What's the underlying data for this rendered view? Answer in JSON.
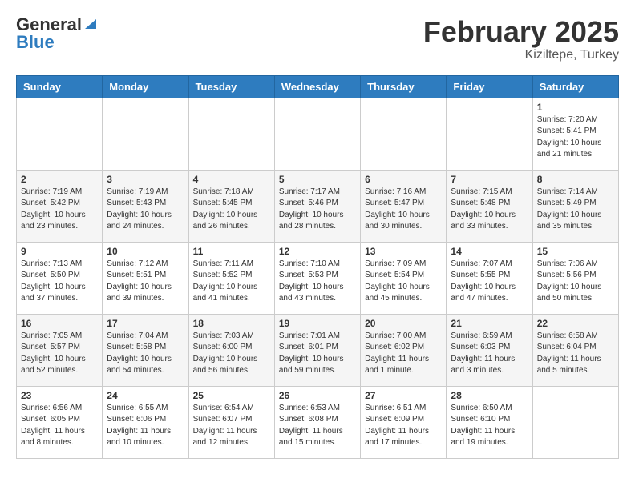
{
  "header": {
    "logo_general": "General",
    "logo_blue": "Blue",
    "month": "February 2025",
    "location": "Kiziltepe, Turkey"
  },
  "weekdays": [
    "Sunday",
    "Monday",
    "Tuesday",
    "Wednesday",
    "Thursday",
    "Friday",
    "Saturday"
  ],
  "weeks": [
    [
      {
        "day": "",
        "info": ""
      },
      {
        "day": "",
        "info": ""
      },
      {
        "day": "",
        "info": ""
      },
      {
        "day": "",
        "info": ""
      },
      {
        "day": "",
        "info": ""
      },
      {
        "day": "",
        "info": ""
      },
      {
        "day": "1",
        "info": "Sunrise: 7:20 AM\nSunset: 5:41 PM\nDaylight: 10 hours\nand 21 minutes."
      }
    ],
    [
      {
        "day": "2",
        "info": "Sunrise: 7:19 AM\nSunset: 5:42 PM\nDaylight: 10 hours\nand 23 minutes."
      },
      {
        "day": "3",
        "info": "Sunrise: 7:19 AM\nSunset: 5:43 PM\nDaylight: 10 hours\nand 24 minutes."
      },
      {
        "day": "4",
        "info": "Sunrise: 7:18 AM\nSunset: 5:45 PM\nDaylight: 10 hours\nand 26 minutes."
      },
      {
        "day": "5",
        "info": "Sunrise: 7:17 AM\nSunset: 5:46 PM\nDaylight: 10 hours\nand 28 minutes."
      },
      {
        "day": "6",
        "info": "Sunrise: 7:16 AM\nSunset: 5:47 PM\nDaylight: 10 hours\nand 30 minutes."
      },
      {
        "day": "7",
        "info": "Sunrise: 7:15 AM\nSunset: 5:48 PM\nDaylight: 10 hours\nand 33 minutes."
      },
      {
        "day": "8",
        "info": "Sunrise: 7:14 AM\nSunset: 5:49 PM\nDaylight: 10 hours\nand 35 minutes."
      }
    ],
    [
      {
        "day": "9",
        "info": "Sunrise: 7:13 AM\nSunset: 5:50 PM\nDaylight: 10 hours\nand 37 minutes."
      },
      {
        "day": "10",
        "info": "Sunrise: 7:12 AM\nSunset: 5:51 PM\nDaylight: 10 hours\nand 39 minutes."
      },
      {
        "day": "11",
        "info": "Sunrise: 7:11 AM\nSunset: 5:52 PM\nDaylight: 10 hours\nand 41 minutes."
      },
      {
        "day": "12",
        "info": "Sunrise: 7:10 AM\nSunset: 5:53 PM\nDaylight: 10 hours\nand 43 minutes."
      },
      {
        "day": "13",
        "info": "Sunrise: 7:09 AM\nSunset: 5:54 PM\nDaylight: 10 hours\nand 45 minutes."
      },
      {
        "day": "14",
        "info": "Sunrise: 7:07 AM\nSunset: 5:55 PM\nDaylight: 10 hours\nand 47 minutes."
      },
      {
        "day": "15",
        "info": "Sunrise: 7:06 AM\nSunset: 5:56 PM\nDaylight: 10 hours\nand 50 minutes."
      }
    ],
    [
      {
        "day": "16",
        "info": "Sunrise: 7:05 AM\nSunset: 5:57 PM\nDaylight: 10 hours\nand 52 minutes."
      },
      {
        "day": "17",
        "info": "Sunrise: 7:04 AM\nSunset: 5:58 PM\nDaylight: 10 hours\nand 54 minutes."
      },
      {
        "day": "18",
        "info": "Sunrise: 7:03 AM\nSunset: 6:00 PM\nDaylight: 10 hours\nand 56 minutes."
      },
      {
        "day": "19",
        "info": "Sunrise: 7:01 AM\nSunset: 6:01 PM\nDaylight: 10 hours\nand 59 minutes."
      },
      {
        "day": "20",
        "info": "Sunrise: 7:00 AM\nSunset: 6:02 PM\nDaylight: 11 hours\nand 1 minute."
      },
      {
        "day": "21",
        "info": "Sunrise: 6:59 AM\nSunset: 6:03 PM\nDaylight: 11 hours\nand 3 minutes."
      },
      {
        "day": "22",
        "info": "Sunrise: 6:58 AM\nSunset: 6:04 PM\nDaylight: 11 hours\nand 5 minutes."
      }
    ],
    [
      {
        "day": "23",
        "info": "Sunrise: 6:56 AM\nSunset: 6:05 PM\nDaylight: 11 hours\nand 8 minutes."
      },
      {
        "day": "24",
        "info": "Sunrise: 6:55 AM\nSunset: 6:06 PM\nDaylight: 11 hours\nand 10 minutes."
      },
      {
        "day": "25",
        "info": "Sunrise: 6:54 AM\nSunset: 6:07 PM\nDaylight: 11 hours\nand 12 minutes."
      },
      {
        "day": "26",
        "info": "Sunrise: 6:53 AM\nSunset: 6:08 PM\nDaylight: 11 hours\nand 15 minutes."
      },
      {
        "day": "27",
        "info": "Sunrise: 6:51 AM\nSunset: 6:09 PM\nDaylight: 11 hours\nand 17 minutes."
      },
      {
        "day": "28",
        "info": "Sunrise: 6:50 AM\nSunset: 6:10 PM\nDaylight: 11 hours\nand 19 minutes."
      },
      {
        "day": "",
        "info": ""
      }
    ]
  ]
}
